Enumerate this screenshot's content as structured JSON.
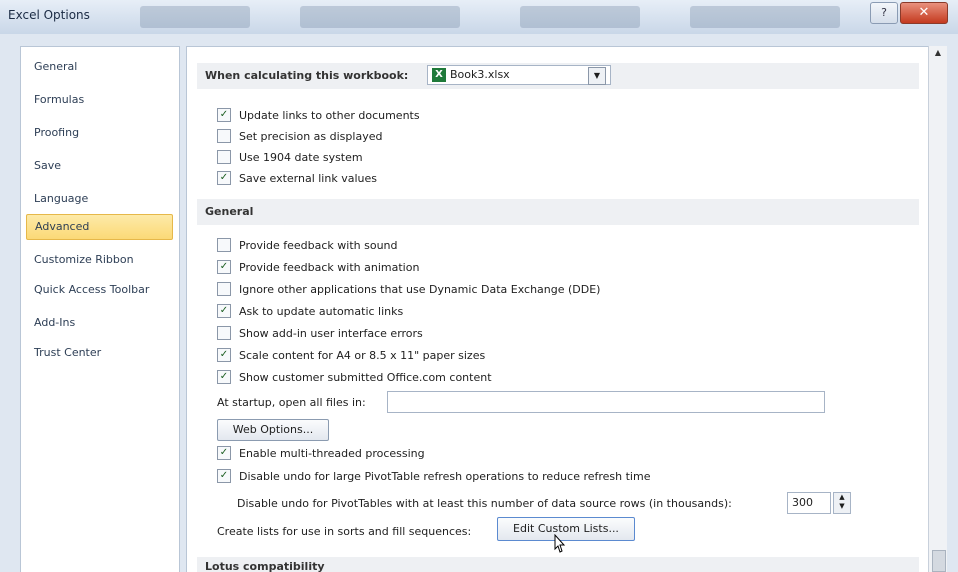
{
  "window": {
    "title": "Excel Options",
    "help_glyph": "?",
    "close_glyph": "✕"
  },
  "sidebar": {
    "items": [
      {
        "label": "General",
        "active": false
      },
      {
        "label": "Formulas",
        "active": false
      },
      {
        "label": "Proofing",
        "active": false
      },
      {
        "label": "Save",
        "active": false
      },
      {
        "label": "Language",
        "active": false
      },
      {
        "label": "Advanced",
        "active": true
      },
      {
        "label": "Customize Ribbon",
        "active": false
      },
      {
        "label": "Quick Access Toolbar",
        "active": false
      },
      {
        "label": "Add-Ins",
        "active": false
      },
      {
        "label": "Trust Center",
        "active": false
      }
    ]
  },
  "workbook": {
    "label": "When calculating this workbook:",
    "selected": "Book3.xlsx",
    "icon_letter": "X",
    "options": [
      {
        "label": "Update links to other documents",
        "checked": true
      },
      {
        "label": "Set precision as displayed",
        "checked": false
      },
      {
        "label": "Use 1904 date system",
        "checked": false
      },
      {
        "label": "Save external link values",
        "checked": true
      }
    ]
  },
  "general": {
    "header": "General",
    "options": [
      {
        "label": "Provide feedback with sound",
        "checked": false
      },
      {
        "label": "Provide feedback with animation",
        "checked": true
      },
      {
        "label": "Ignore other applications that use Dynamic Data Exchange (DDE)",
        "checked": false
      },
      {
        "label": "Ask to update automatic links",
        "checked": true
      },
      {
        "label": "Show add-in user interface errors",
        "checked": false
      },
      {
        "label": "Scale content for A4 or 8.5 x 11\" paper sizes",
        "checked": true
      },
      {
        "label": "Show customer submitted Office.com content",
        "checked": true
      }
    ],
    "startup_label": "At startup, open all files in:",
    "startup_value": "",
    "web_options_label": "Web Options...",
    "multithread_label": "Enable multi-threaded processing",
    "multithread_checked": true,
    "disable_undo_label": "Disable undo for large PivotTable refresh operations to reduce refresh time",
    "disable_undo_checked": true,
    "pivot_rows_label": "Disable undo for PivotTables with at least this number of data source rows (in thousands):",
    "pivot_rows_value": "300",
    "custom_lists_label": "Create lists for use in sorts and fill sequences:",
    "custom_lists_button": "Edit Custom Lists..."
  },
  "lotus": {
    "header": "Lotus compatibility"
  },
  "scroll": {
    "up": "▲",
    "down": "▼"
  },
  "icons": {
    "check": "✓",
    "spin_up": "▲",
    "spin_down": "▼",
    "combo_drop": "▼"
  },
  "colors": {
    "active_nav": "#fbd977",
    "excel_green": "#1f7a3a",
    "close_red": "#c43a1f"
  }
}
